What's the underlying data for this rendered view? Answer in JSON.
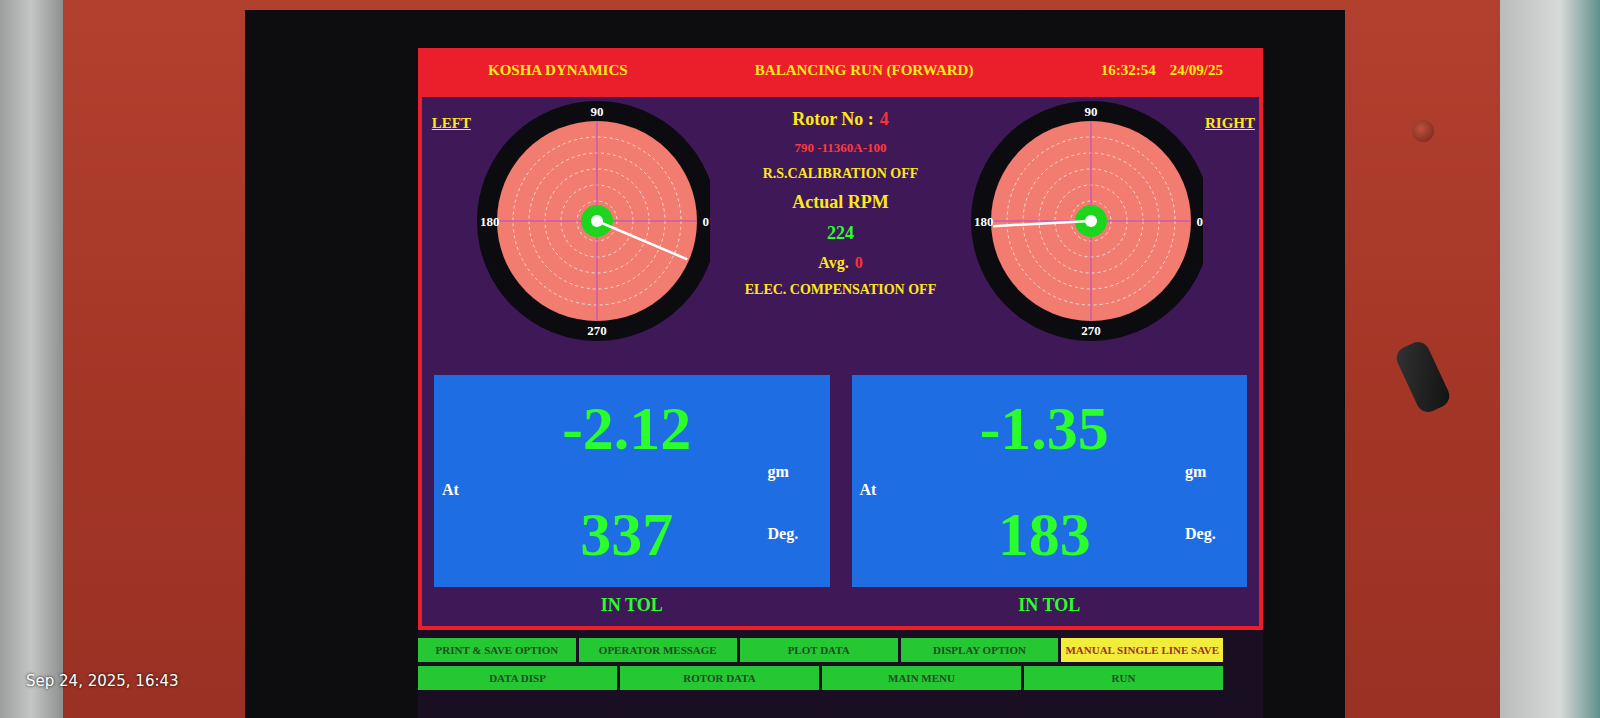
{
  "frame": {
    "timestamp": "Sep 24, 2025, 16:43"
  },
  "header": {
    "brand": "KOSHA DYNAMICS",
    "title": "BALANCING RUN (FORWARD)",
    "time": "16:32:54",
    "date": "24/09/25"
  },
  "center": {
    "rotor_label": "Rotor No :",
    "rotor_no": "4",
    "part_no": "790 -11360A-100",
    "rs_calibration": "R.S.CALIBRATION OFF",
    "rpm_label": "Actual RPM",
    "rpm": "224",
    "avg_label": "Avg.",
    "avg": "0",
    "compensation": "ELEC. COMPENSATION OFF"
  },
  "planes": [
    {
      "side": "LEFT",
      "axis_labels": [
        "90",
        "180",
        "0",
        "270"
      ],
      "needle_deg": 337,
      "weight": "-2.12",
      "weight_unit": "gm",
      "at_label": "At",
      "angle": "337",
      "angle_unit": "Deg.",
      "status": "IN TOL"
    },
    {
      "side": "RIGHT",
      "axis_labels": [
        "90",
        "180",
        "0",
        "270"
      ],
      "needle_deg": 183,
      "weight": "-1.35",
      "weight_unit": "gm",
      "at_label": "At",
      "angle": "183",
      "angle_unit": "Deg.",
      "status": "IN TOL"
    }
  ],
  "buttons": [
    [
      {
        "label": "PRINT & SAVE OPTION",
        "highlighted": false
      },
      {
        "label": "OPERATOR MESSAGE",
        "highlighted": false
      },
      {
        "label": "PLOT DATA",
        "highlighted": false
      },
      {
        "label": "DISPLAY OPTION",
        "highlighted": false
      },
      {
        "label": "MANUAL SINGLE LINE SAVE",
        "highlighted": true
      }
    ],
    [
      {
        "label": "DATA DISP",
        "highlighted": false
      },
      {
        "label": "ROTOR DATA",
        "highlighted": false
      },
      {
        "label": "MAIN MENU",
        "highlighted": false
      },
      {
        "label": "RUN",
        "highlighted": false
      }
    ]
  ]
}
